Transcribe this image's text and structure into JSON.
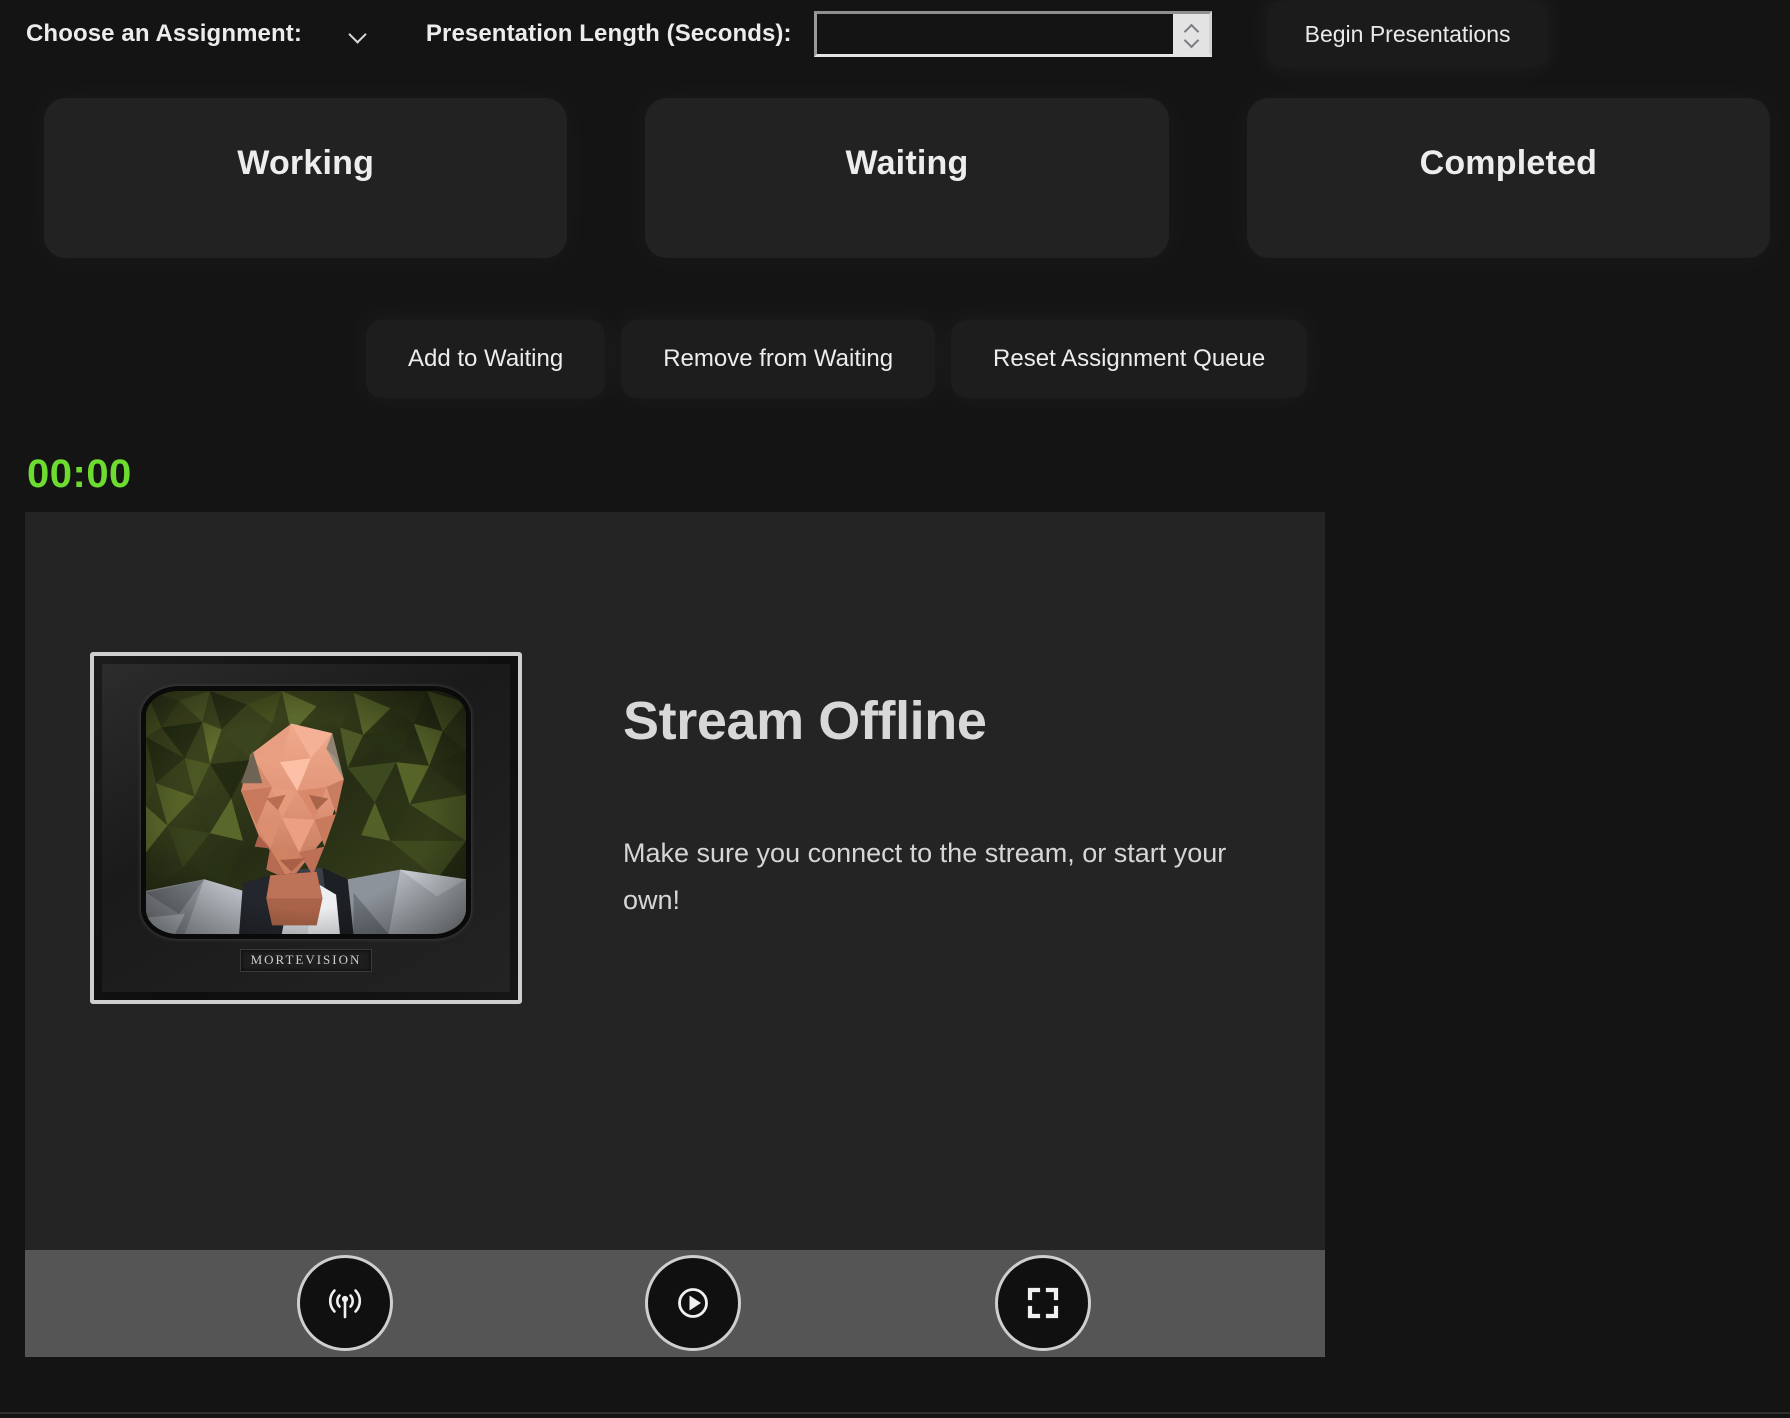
{
  "toolbar": {
    "assignment_label": "Choose an Assignment:",
    "assignment_selected": "",
    "assignment_chevron_icon": "chevron-down-icon",
    "length_label": "Presentation Length (Seconds):",
    "length_value": "",
    "length_placeholder": "",
    "spinner_up_icon": "chevron-up-icon",
    "spinner_down_icon": "chevron-down-icon",
    "begin_label": "Begin Presentations"
  },
  "columns": [
    {
      "title": "Working"
    },
    {
      "title": "Waiting"
    },
    {
      "title": "Completed"
    }
  ],
  "actions": [
    {
      "label": "Add to Waiting"
    },
    {
      "label": "Remove from Waiting"
    },
    {
      "label": "Reset Assignment Queue"
    }
  ],
  "timer": {
    "value": "00:00",
    "color": "#6ddb2f"
  },
  "video": {
    "tv_brand": "MORTEVISION",
    "offline_title": "Stream Offline",
    "offline_message": "Make sure you connect to the stream, or start your own!",
    "controls": [
      {
        "name": "broadcast-icon",
        "label": "Broadcast"
      },
      {
        "name": "play-icon",
        "label": "Play"
      },
      {
        "name": "fullscreen-icon",
        "label": "Fullscreen"
      }
    ]
  },
  "colors": {
    "background": "#141414",
    "panel": "#222222",
    "video_panel": "#242424",
    "control_bar": "#555555",
    "text": "#ececec",
    "timer_green": "#6ddb2f"
  }
}
